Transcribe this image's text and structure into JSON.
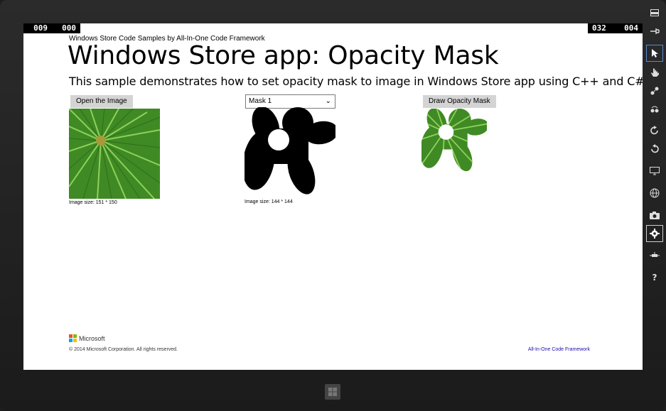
{
  "counters": {
    "left_a": "009",
    "left_b": "000",
    "right_a": "032",
    "right_b": "004"
  },
  "header": {
    "subtitle": "Windows Store Code Samples by All-In-One Code Framework",
    "title": "Windows Store app: Opacity Mask",
    "description": "This sample demonstrates how to set opacity mask to image in Windows Store app using C++ and C#."
  },
  "controls": {
    "open_button": "Open the Image",
    "mask_select": "Mask 1",
    "draw_button": "Draw Opacity Mask"
  },
  "captions": {
    "image_size": "Image size: 151 * 150",
    "mask_size": "Image size: 144 * 144"
  },
  "footer": {
    "logo_text": "Microsoft",
    "copyright": "© 2014 Microsoft Corporation. All rights reserved.",
    "link": "All-In-One Code Framework"
  },
  "colors": {
    "accent": "#5a8ad6",
    "link": "#1a0dab",
    "leaf": "#4f9a2e"
  },
  "toolbar_icons": [
    "minimize-icon",
    "pin-icon",
    "pointer-icon",
    "hand-icon",
    "pinch-icon",
    "rotate-gesture-icon",
    "rotate-clockwise-icon",
    "rotate-counterclockwise-icon",
    "resolution-icon",
    "globe-icon",
    "camera-icon",
    "settings-icon",
    "network-icon",
    "help-icon"
  ]
}
